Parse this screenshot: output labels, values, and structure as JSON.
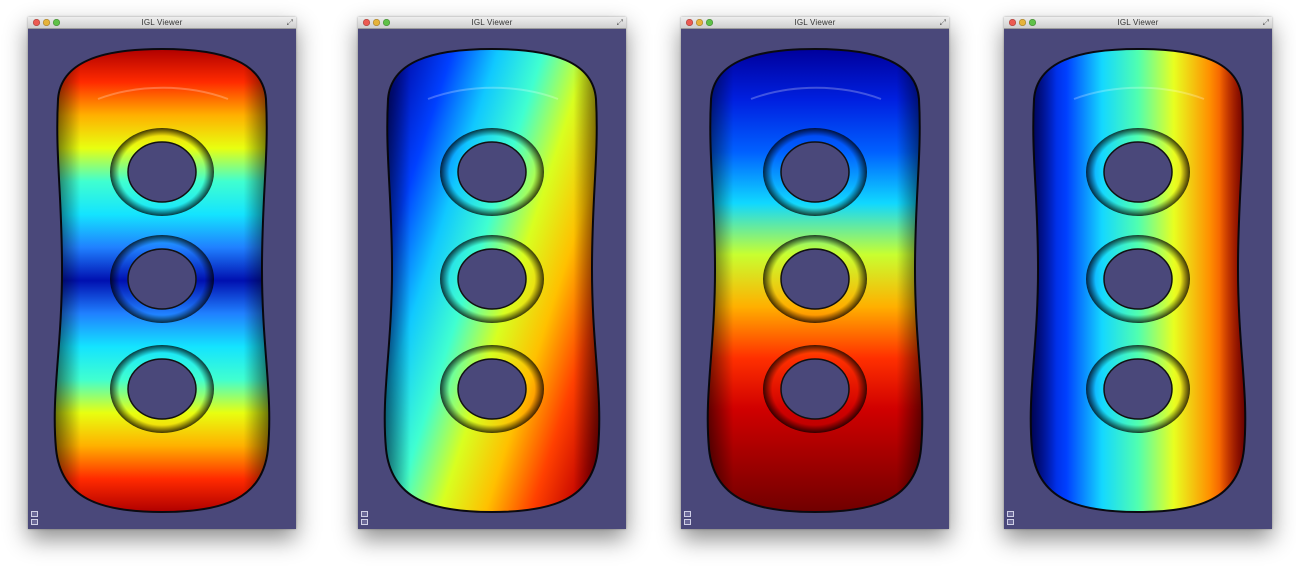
{
  "windows": [
    {
      "title": "IGL Viewer",
      "colormap": "vertical-blue-center",
      "stops": [
        "#b00000",
        "#ff2a00",
        "#ffb000",
        "#e8ff10",
        "#40ffd0",
        "#14e4ff",
        "#2080ff",
        "#0010b0",
        "#2080ff",
        "#14e4ff",
        "#40ffd0",
        "#e8ff10",
        "#ffb000",
        "#ff2a00",
        "#b00000"
      ]
    },
    {
      "title": "IGL Viewer",
      "colormap": "diagonal-blue-to-red",
      "stops": [
        "#0010b0",
        "#0040ff",
        "#10c8ff",
        "#40ffd0",
        "#d8ff20",
        "#ffc000",
        "#ff4000",
        "#c00000"
      ]
    },
    {
      "title": "IGL Viewer",
      "colormap": "vertical-blue-to-red",
      "stops": [
        "#00009c",
        "#0020e0",
        "#0060ff",
        "#10d8ff",
        "#c8ff30",
        "#ffb000",
        "#ff3000",
        "#d00000",
        "#a00000",
        "#700000"
      ]
    },
    {
      "title": "IGL Viewer",
      "colormap": "horizontal-blue-to-red",
      "stops": [
        "#0008b0",
        "#0040ff",
        "#14d8ff",
        "#50ffb0",
        "#e8ff20",
        "#ff9000",
        "#e00000"
      ]
    }
  ],
  "colors": {
    "background": "#4a487a",
    "outline": "#0a0a10"
  }
}
